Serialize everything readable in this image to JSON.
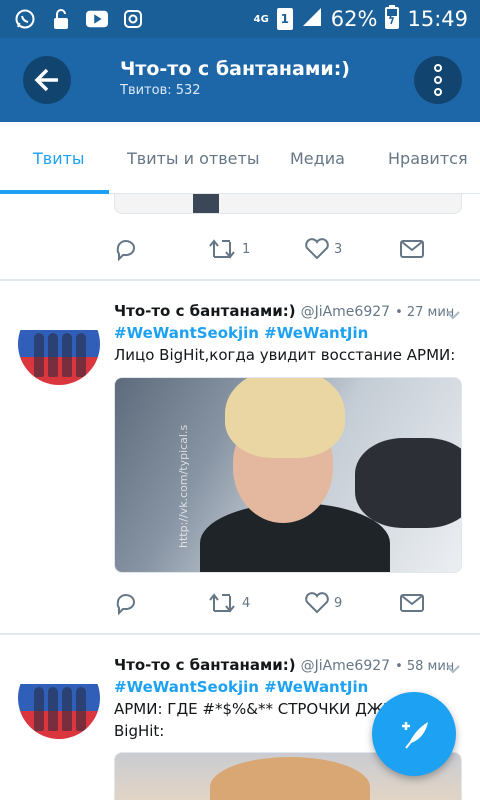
{
  "status_bar": {
    "network": "4G",
    "sim": "1",
    "battery": "62%",
    "time": "15:49"
  },
  "app_bar": {
    "title": "Что-то с бантанами:)",
    "subtitle": "Твитов: 532"
  },
  "tabs": [
    {
      "label": "Твиты",
      "active": true
    },
    {
      "label": "Твиты и ответы",
      "active": false
    },
    {
      "label": "Медиа",
      "active": false
    },
    {
      "label": "Нравится",
      "active": false
    }
  ],
  "tweets": [
    {
      "retweets": "1",
      "likes": "3"
    },
    {
      "name": "Что-то с бантанами:)",
      "handle": "@JiAme6927",
      "time": "• 27 мин",
      "hashtags": "#WeWantSeokjin #WeWantJin",
      "text": "Лицо BigHit,когда увидит восстание АРМИ:",
      "media_watermark": "http://vk.com/typical.s",
      "retweets": "4",
      "likes": "9"
    },
    {
      "name": "Что-то с бантанами:)",
      "handle": "@JiAme6927",
      "time": "• 58 мин",
      "hashtags": "#WeWantSeokjin #WeWantJin",
      "text": "АРМИ: ГДЕ #*$%&** СТРОЧКИ ДЖИ BigHit:"
    }
  ],
  "colors": {
    "status_bar": "#1b5f98",
    "app_bar": "#1d67a8",
    "accent": "#1da1f2"
  }
}
